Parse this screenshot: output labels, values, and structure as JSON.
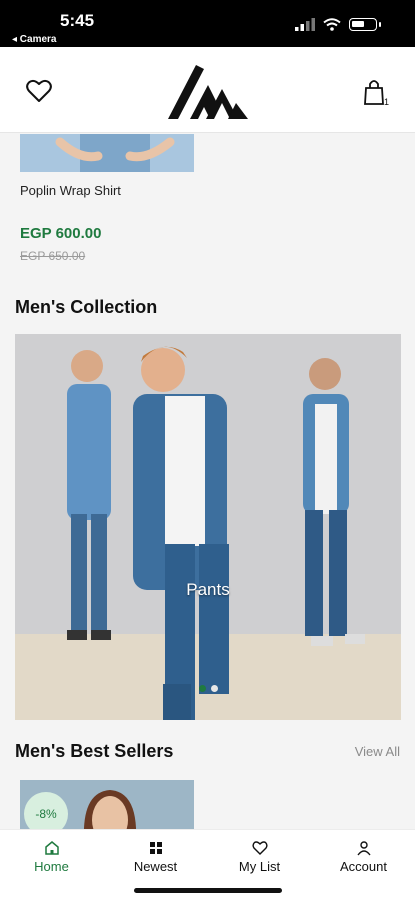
{
  "status_bar": {
    "time": "5:45",
    "back_label": "◂ Camera"
  },
  "header": {
    "heart_icon": "heart-icon",
    "logo_icon": "brand-logo",
    "cart_icon": "shopping-bag-icon",
    "cart_count": "1"
  },
  "product": {
    "name": "Poplin Wrap Shirt",
    "price": "EGP 600.00",
    "old_price": "EGP 650.00"
  },
  "mens_collection": {
    "title": "Men's Collection",
    "banner_caption": "Pants",
    "slide_count": 2,
    "active_slide": 1
  },
  "best_sellers": {
    "title": "Men's Best Sellers",
    "view_all": "View All",
    "discount": "-8%"
  },
  "bottom_nav": {
    "items": [
      {
        "label": "Home",
        "icon": "home-icon",
        "active": true
      },
      {
        "label": "Newest",
        "icon": "grid-icon",
        "active": false
      },
      {
        "label": "My List",
        "icon": "heart-icon",
        "active": false
      },
      {
        "label": "Account",
        "icon": "person-icon",
        "active": false
      }
    ]
  },
  "colors": {
    "accent": "#1f7a3f",
    "background": "#f4f4f4"
  }
}
